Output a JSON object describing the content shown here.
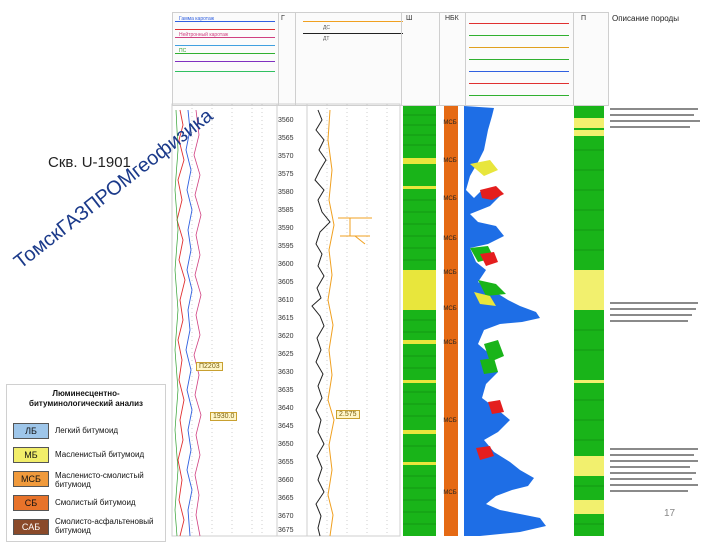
{
  "well_title": "Скв. U-1901",
  "company_watermark": "ТомскГАЗПРОМгеофизика",
  "header": {
    "column_heads": [
      "Г",
      "Ш",
      "НБК",
      "П"
    ],
    "tiny_text": [
      "Гамма каротаж",
      "Нейтронный каротаж",
      "ПС",
      "ДС",
      "ДТ"
    ],
    "description_title": "Описание породы"
  },
  "depth_ticks": [
    "3560",
    "3565",
    "3570",
    "3575",
    "3580",
    "3585",
    "3590",
    "3595",
    "3600",
    "3605",
    "3610",
    "3615",
    "3620",
    "3625",
    "3630",
    "3635",
    "3640",
    "3645",
    "3650",
    "3655",
    "3660",
    "3665",
    "3670",
    "3675"
  ],
  "annotations": {
    "marker_1": "П2203",
    "marker_2": "1930.0",
    "marker_3": "2.575"
  },
  "lum_codes": [
    "МСБ",
    "МСБ",
    "МСБ",
    "МСБ",
    "МСБ",
    "МСБ",
    "МСБ",
    "МСБ",
    "МСБ"
  ],
  "legend": {
    "title": "Люминесцентно-битуминологический анализ",
    "items": [
      {
        "code": "ЛБ",
        "label": "Легкий битумоид",
        "color": "#9ec6ea"
      },
      {
        "code": "МБ",
        "label": "Масленистый битумоид",
        "color": "#f2ee6a"
      },
      {
        "code": "МСБ",
        "label": "Масленисто-смолистый битумоид",
        "color": "#f09a3c"
      },
      {
        "code": "СБ",
        "label": "Смолистый битумоид",
        "color": "#e8732a"
      },
      {
        "code": "САБ",
        "label": "Смолисто-асфальтеновый битумоид",
        "color": "#8a4a2a"
      }
    ]
  },
  "page_number": "17",
  "colors": {
    "green": "#19b419",
    "orange": "#e56a14",
    "blue": "#1e6ee6",
    "yellow": "#e8e63c",
    "red": "#e41e1e"
  }
}
